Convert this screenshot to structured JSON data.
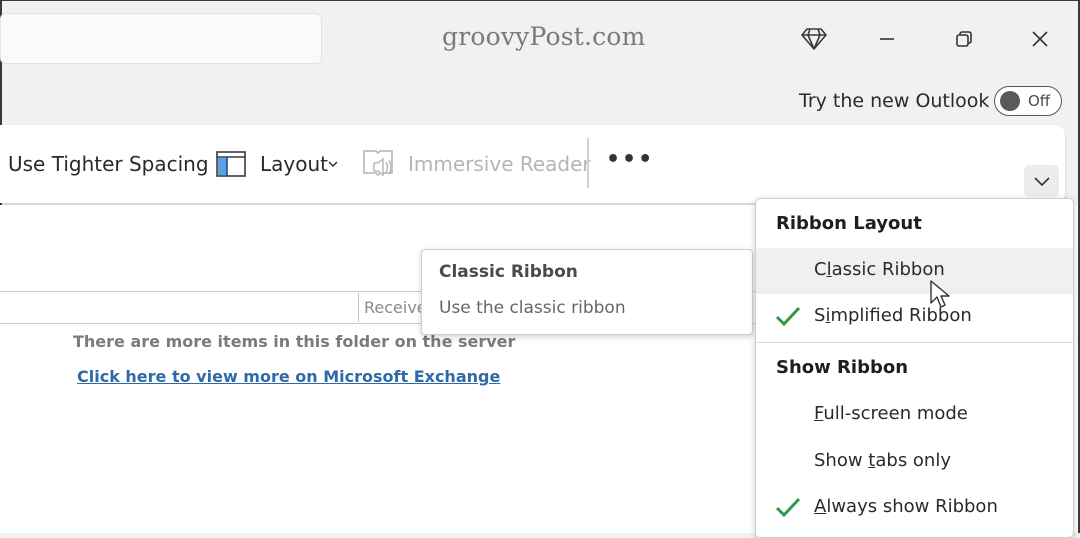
{
  "titlebar": {
    "brand": "groovyPost.com",
    "icons": [
      "diamond-icon",
      "minimize-icon",
      "restore-icon",
      "close-icon"
    ],
    "try_new_outlook_label": "Try the new Outlook",
    "toggle_state_label": "Off"
  },
  "ribbon": {
    "items": [
      {
        "label": "Use Tighter Spacing",
        "enabled": true
      },
      {
        "label": "Layout",
        "icon": "layout-icon",
        "has_dropdown": true,
        "enabled": true
      },
      {
        "label": "Immersive Reader",
        "icon": "immersive-reader-icon",
        "enabled": false
      }
    ],
    "more_label": "•••",
    "collapse_icon": "chevron-down-icon"
  },
  "message_list": {
    "columns": [
      "Receive"
    ],
    "notice": "There are more items in this folder on the server",
    "link": "Click here to view more on Microsoft Exchange"
  },
  "tooltip": {
    "title": "Classic Ribbon",
    "description": "Use the classic ribbon"
  },
  "ribbon_menu": {
    "sections": [
      {
        "header": "Ribbon Layout",
        "items": [
          {
            "pre": "C",
            "accel": "l",
            "post": "assic Ribbon",
            "checked": false,
            "hovered": true
          },
          {
            "pre": "S",
            "accel": "i",
            "post": "mplified Ribbon",
            "checked": true,
            "hovered": false
          }
        ]
      },
      {
        "header": "Show Ribbon",
        "items": [
          {
            "pre": "",
            "accel": "F",
            "post": "ull-screen mode",
            "checked": false,
            "hovered": false
          },
          {
            "pre": "Show ",
            "accel": "t",
            "post": "abs only",
            "checked": false,
            "hovered": false
          },
          {
            "pre": "",
            "accel": "A",
            "post": "lways show Ribbon",
            "checked": true,
            "hovered": false
          }
        ]
      }
    ],
    "check_color": "#2e9b4a"
  },
  "colors": {
    "link": "#2f6aa8",
    "layout_icon_accent": "#5aa0e6"
  }
}
